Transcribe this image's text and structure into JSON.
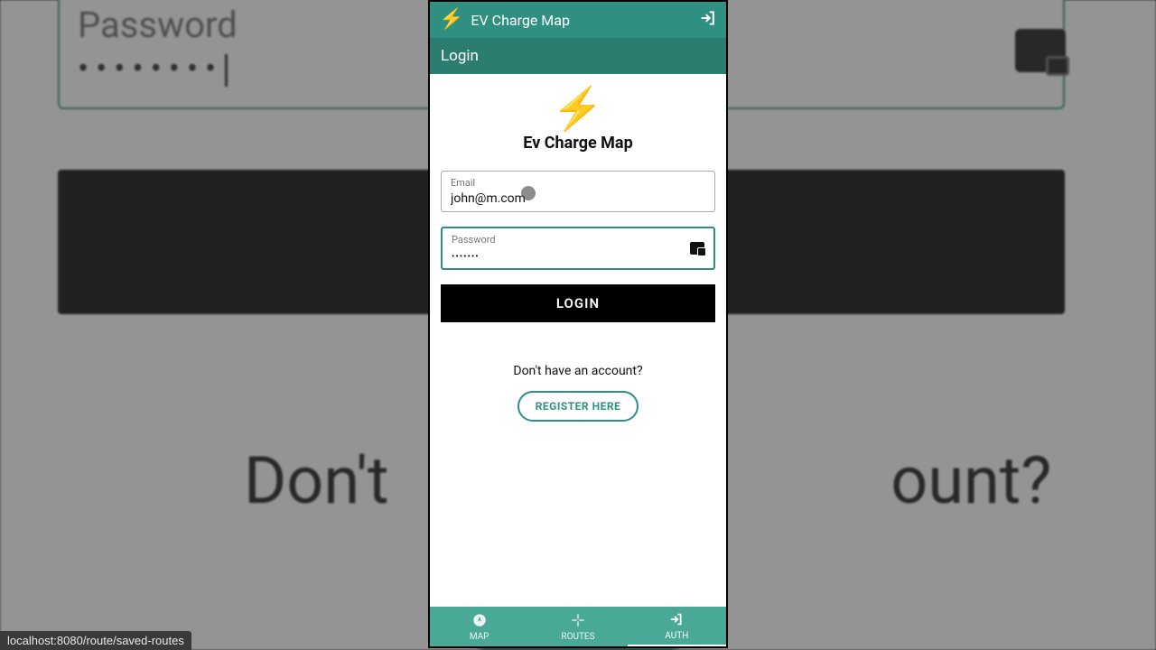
{
  "background": {
    "password_label": "Password",
    "password_dots": "••••••••",
    "prompt_left": "Don't",
    "prompt_right": "ount?"
  },
  "header": {
    "app_title": "EV Charge Map",
    "sub_title": "Login"
  },
  "logo": {
    "title": "Ev Charge Map"
  },
  "form": {
    "email_label": "Email",
    "email_value": "john@m.com",
    "password_label": "Password",
    "password_value": "•••••••",
    "login_button": "LOGIN",
    "prompt": "Don't have an account?",
    "register_button": "REGISTER HERE"
  },
  "nav": {
    "map": "MAP",
    "routes": "ROUTES",
    "auth": "AUTH"
  },
  "status_bar": "localhost:8080/route/saved-routes",
  "colors": {
    "brand_teal": "#2f8f80",
    "bolt_yellow": "#f4d300"
  }
}
